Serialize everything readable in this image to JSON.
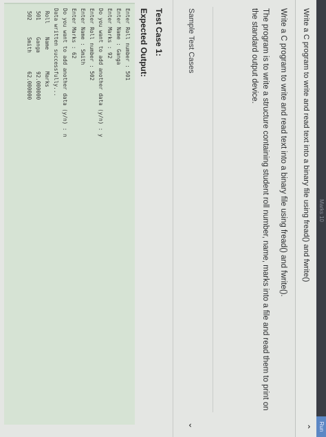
{
  "top_bar": {
    "pill_label": "Run",
    "faded_label": "Marks 10"
  },
  "header": {
    "title": "Write a C program to write and read text into a binary file using fread() and fwrite()"
  },
  "problem": {
    "line1": "Write a C program to write and read text into a binary file using fread() and fwrite().",
    "line2": "The program is to write a structure containing student roll number, name, marks into a file and read them to print on the standard output device."
  },
  "sample_test_cases": {
    "label": "Sample Test Cases"
  },
  "test_case": {
    "title": "Test Case 1:",
    "expected_title": "Expected Output:",
    "output_lines": [
      "Enter Roll number : 501",
      "Enter Name : Ganga",
      "Enter Marks : 92",
      "Do you want to add another data (y/n) : y",
      "Enter Roll number : 502",
      "Enter Name : Smith",
      "Enter Marks : 62",
      "Do you want to add another data (y/n) : n",
      "Data written successfully..."
    ],
    "table_header": [
      "Roll",
      "Name",
      "Marks"
    ],
    "table_rows": [
      [
        "501",
        "Ganga",
        "92.000000"
      ],
      [
        "502",
        "Smith",
        "62.000000"
      ]
    ]
  }
}
